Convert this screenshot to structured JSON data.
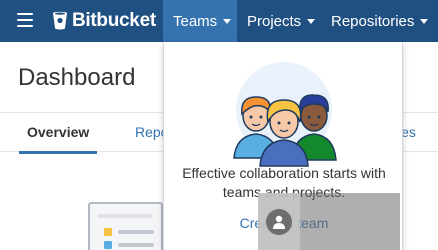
{
  "header": {
    "brand": "Bitbucket",
    "nav": [
      {
        "label": "Teams"
      },
      {
        "label": "Projects"
      },
      {
        "label": "Repositories"
      }
    ]
  },
  "page": {
    "title": "Dashboard",
    "tabs": [
      {
        "label": "Overview"
      },
      {
        "label": "Repo"
      },
      {
        "label": "ies"
      }
    ]
  },
  "teams_dropdown": {
    "message": "Effective collaboration starts with teams and projects.",
    "link": "Create a team"
  },
  "colors": {
    "topbar": "#205081",
    "active_nav": "#3572b0",
    "link": "#3572b0"
  }
}
